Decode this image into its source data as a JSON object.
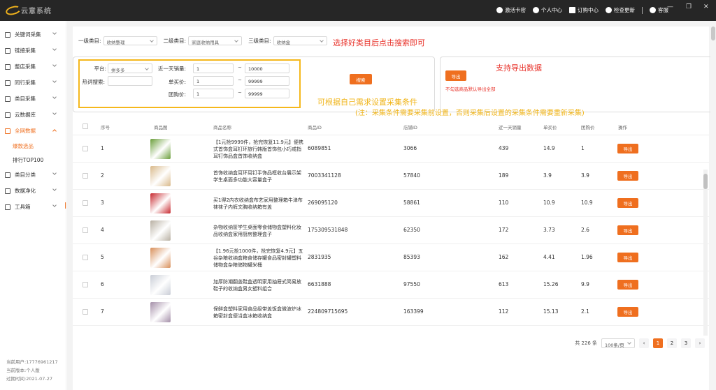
{
  "titlebar": {
    "brand": "云意系统",
    "actions": [
      "激活卡密",
      "个人中心",
      "订购中心",
      "检查更新",
      "客服"
    ]
  },
  "sidebar": {
    "items": [
      {
        "label": "关键词采集",
        "icon": "text-icon"
      },
      {
        "label": "链接采集",
        "icon": "link-icon"
      },
      {
        "label": "整店采集",
        "icon": "shop-icon"
      },
      {
        "label": "同行采集",
        "icon": "user-icon"
      },
      {
        "label": "类目采集",
        "icon": "category-icon"
      },
      {
        "label": "云数据库",
        "icon": "cloud-icon"
      },
      {
        "label": "全网数据",
        "icon": "globe-icon"
      }
    ],
    "sub_items": [
      "爆款选品",
      "排行TOP100"
    ],
    "items_after": [
      {
        "label": "类目分类",
        "icon": "grid-icon"
      },
      {
        "label": "数据净化",
        "icon": "filter-icon"
      },
      {
        "label": "工具箱",
        "icon": "toolbox-icon"
      }
    ],
    "footer": {
      "user": "当前用户:17776961217",
      "version": "当前版本:个人版",
      "expire": "过期时间:2021-07-27"
    }
  },
  "filters": {
    "cat1_label": "一级类目:",
    "cat1_value": "收纳整理",
    "cat2_label": "二级类目:",
    "cat2_value": "家庭收纳用具",
    "cat3_label": "三级类目:",
    "cat3_value": "收纳盒"
  },
  "conditions": {
    "platform_label": "平台:",
    "platform_value": "拼多多",
    "sales_label": "近一天销量:",
    "sales_min": "1",
    "sales_max": "10000",
    "hot_label": "热词搜索:",
    "hot_value": "",
    "single_label": "单买价:",
    "single_min": "1",
    "single_max": "99999",
    "group_label": "团购价:",
    "group_min": "1",
    "group_max": "99999",
    "tilde": "~"
  },
  "search_button": "搜索",
  "export": {
    "button": "导出",
    "note": "不勾选商品默认导出全部"
  },
  "annotations": {
    "select_category": "选择好类目后点击搜索即可",
    "export_support": "支持导出数据",
    "set_conditions": "可根据自己需求设置采集条件",
    "note": "(注：采集条件需要采集前设置，否则采集后设置的采集条件需要重新采集)"
  },
  "table": {
    "headers": [
      "序号",
      "商品图",
      "商品名称",
      "商品ID",
      "店铺ID",
      "近一天销量",
      "单买价",
      "团购价",
      "操作"
    ],
    "export_label": "导出",
    "rows": [
      {
        "no": "1",
        "name": "【1元抢9999件，抢完恢复11.9元】便携式首饰盒耳钉环旅行韩版首饰包小巧戒指耳钉饰品盒首饰收纳盒",
        "id": "6089851",
        "shop": "3066",
        "sales": "439",
        "single": "14.9",
        "group": "1",
        "img": "#6a9e3a"
      },
      {
        "no": "2",
        "name": "首饰收纳盒耳环耳钉手饰品框收台展示架学生桌面多功能大容量盒子",
        "id": "7003341128",
        "shop": "57840",
        "sales": "189",
        "single": "3.9",
        "group": "3.9",
        "img": "#d9b98a"
      },
      {
        "no": "3",
        "name": "买1得2内衣收纳盒布艺家用整理箱牛津布袜袜子内裤文胸收纳箱有盖",
        "id": "269095120",
        "shop": "58861",
        "sales": "110",
        "single": "10.9",
        "group": "10.9",
        "img": "#c8292f"
      },
      {
        "no": "4",
        "name": "杂物收纳筐学生桌面零食储物盒塑料化妆品收纳盒家用厨房整理盒子",
        "id": "175309531848",
        "shop": "62350",
        "sales": "172",
        "single": "3.73",
        "group": "2.6",
        "img": "#b8b0a2"
      },
      {
        "no": "5",
        "name": "【1.96元抢1000件，抢完恢复4.9元】五谷杂粮收纳盒粮食储存罐食品密封罐塑料储物盒杂粮储物罐米桶",
        "id": "2831935",
        "shop": "85393",
        "sales": "162",
        "single": "4.41",
        "group": "1.96",
        "img": "#d88f5a"
      },
      {
        "no": "6",
        "name": "加厚防潮翻盖鞋盒透明家用抽屉式简易放鞋子的收纳盒男女塑料组合",
        "id": "6631888",
        "shop": "97550",
        "sales": "613",
        "single": "15.26",
        "group": "9.9",
        "img": "#c9cdd6"
      },
      {
        "no": "7",
        "name": "保鲜盒塑料家用食品级带盖饭盒微波炉冰箱密封盒便当盒冰箱收纳盒",
        "id": "224809715695",
        "shop": "163399",
        "sales": "112",
        "single": "15.13",
        "group": "2.1",
        "img": "#a48fa8"
      }
    ]
  },
  "pagination": {
    "total": "共 226 条",
    "page_size": "100条/页",
    "pages": [
      "1",
      "2",
      "3"
    ],
    "prev": "‹",
    "next": "›"
  },
  "colors": {
    "accent": "#ef6f1f",
    "highlight": "#f5b81c",
    "annotation": "#e8322a"
  }
}
